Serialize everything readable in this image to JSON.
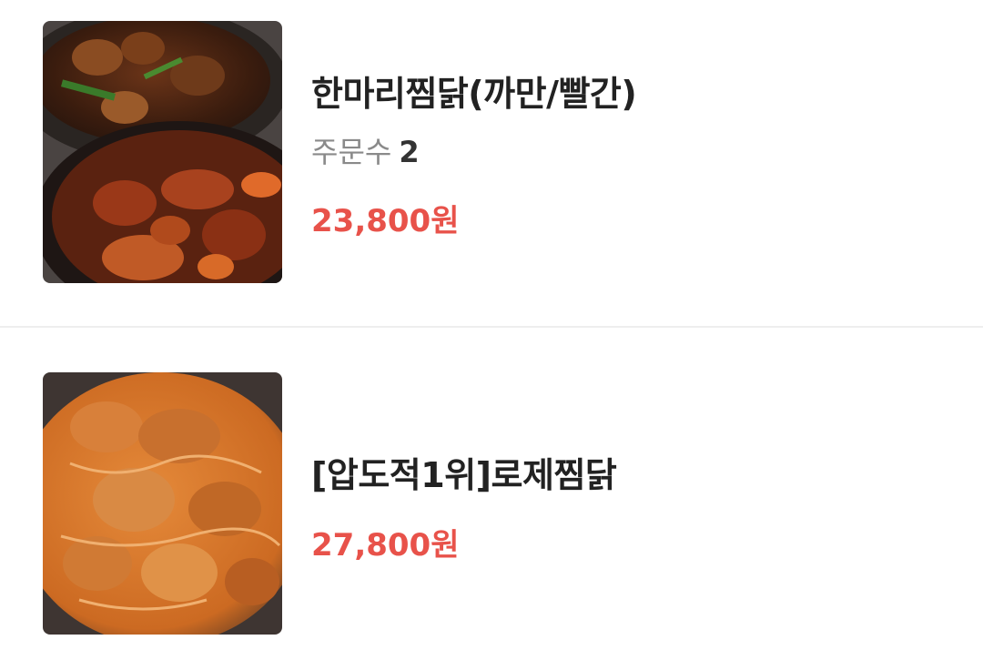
{
  "menu": {
    "items": [
      {
        "image_icon": "dark-jjimdak-dish-image",
        "name": "한마리찜닭(까만/빨간)",
        "orders_label": "주문수",
        "orders_count": "2",
        "price": "23,800원"
      },
      {
        "image_icon": "rose-jjimdak-dish-image",
        "name": "[압도적1위]로제찜닭",
        "price": "27,800원"
      }
    ]
  }
}
